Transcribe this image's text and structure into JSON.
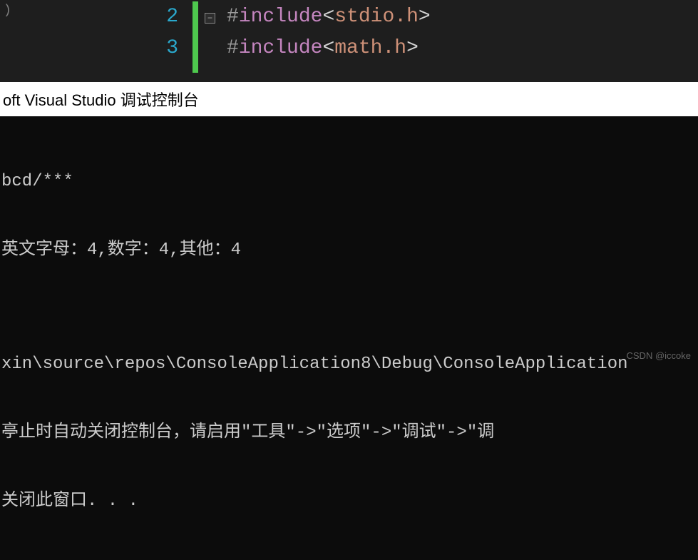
{
  "editor": {
    "paren_fragment": ")",
    "lines": [
      {
        "num": "2",
        "directive": "#",
        "keyword": "include",
        "open": "<",
        "header": "stdio.h",
        "close": ">"
      },
      {
        "num": "3",
        "directive": "#",
        "keyword": "include",
        "open": "<",
        "header": "math.h",
        "close": ">"
      }
    ],
    "fold_glyph": "−"
  },
  "console": {
    "title": "oft Visual Studio 调试控制台",
    "lines": [
      "bcd/***",
      "英文字母：4,数字：4,其他：4",
      "",
      "xin\\source\\repos\\ConsoleApplication8\\Debug\\ConsoleApplication",
      "亭止时自动关闭控制台，请启用\"工具\"->\"选项\"->\"调试\"->\"调",
      "关闭此窗口. . ."
    ]
  },
  "watermark": "CSDN @iccoke"
}
